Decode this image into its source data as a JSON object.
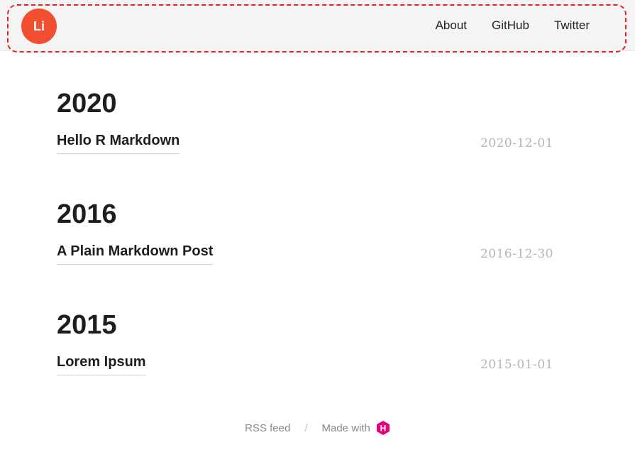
{
  "header": {
    "logo_text": "Li",
    "nav": [
      {
        "label": "About"
      },
      {
        "label": "GitHub"
      },
      {
        "label": "Twitter"
      }
    ],
    "highlight_color": "#e8202a",
    "logo_color": "#f14e32"
  },
  "archive": [
    {
      "year": "2020",
      "posts": [
        {
          "title": "Hello R Markdown",
          "date": "2020-12-01"
        }
      ]
    },
    {
      "year": "2016",
      "posts": [
        {
          "title": "A Plain Markdown Post",
          "date": "2016-12-30"
        }
      ]
    },
    {
      "year": "2015",
      "posts": [
        {
          "title": "Lorem Ipsum",
          "date": "2015-01-01"
        }
      ]
    }
  ],
  "footer": {
    "rss_label": "RSS feed",
    "separator": "/",
    "made_with_label": "Made with",
    "made_with_icon": "hugo-icon",
    "icon_letter": "H",
    "icon_color": "#e6007e"
  }
}
